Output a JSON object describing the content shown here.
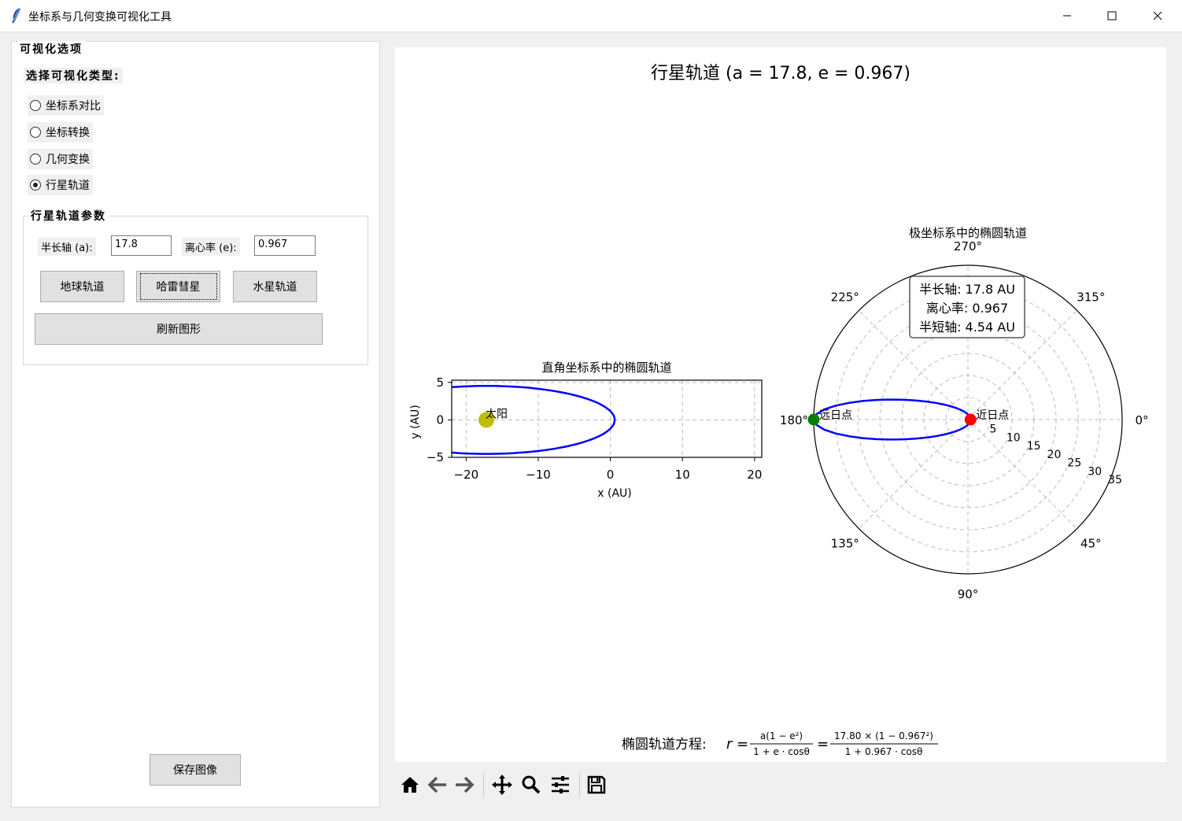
{
  "window": {
    "title": "坐标系与几何变换可视化工具"
  },
  "sidebar": {
    "group_title": "可视化选项",
    "type_label": "选择可视化类型:",
    "radios": [
      {
        "label": "坐标系对比",
        "selected": false
      },
      {
        "label": "坐标转换",
        "selected": false
      },
      {
        "label": "几何变换",
        "selected": false
      },
      {
        "label": "行星轨道",
        "selected": true
      }
    ],
    "params_title": "行星轨道参数",
    "a_label": "半长轴 (a):",
    "a_value": "17.8",
    "e_label": "离心率 (e):",
    "e_value": "0.967",
    "preset_buttons": [
      "地球轨道",
      "哈雷彗星",
      "水星轨道"
    ],
    "refresh_label": "刷新图形",
    "save_label": "保存图像"
  },
  "figure": {
    "suptitle": "行星轨道 (a = 17.8, e = 0.967)",
    "equation_prefix": "椭圆轨道方程:",
    "equation_general_num": "a(1 − e²)",
    "equation_general_den": "1 + e · cosθ",
    "equation_specific_num": "17.80 × (1 − 0.967²)",
    "equation_specific_den": "1 + 0.967 · cosθ"
  },
  "chart_data": [
    {
      "type": "line",
      "title": "直角坐标系中的椭圆轨道",
      "xlabel": "x (AU)",
      "ylabel": "y (AU)",
      "xlim": [
        -22,
        21
      ],
      "ylim": [
        -5,
        5.3
      ],
      "xticks": [
        "−20",
        "−10",
        "0",
        "10",
        "20"
      ],
      "yticks": [
        "5",
        "0",
        "−5"
      ],
      "grid": true,
      "series": [
        {
          "name": "",
          "color": "#0000ff",
          "semi_major": 17.8,
          "eccentricity": 0.967,
          "center_x": -17.2,
          "semi_minor": 4.54
        }
      ],
      "points": [
        {
          "label": "太阳",
          "x": -17.2,
          "y": 0,
          "color": "#bfbf00"
        }
      ]
    },
    {
      "type": "polar",
      "title": "极坐标系中的椭圆轨道",
      "theta_labels": [
        "0°",
        "315°",
        "270°",
        "225°",
        "180°",
        "135°",
        "90°",
        "45°"
      ],
      "r_labels": [
        "5",
        "10",
        "15",
        "20",
        "25",
        "30",
        "35"
      ],
      "rmax": 35,
      "grid": true,
      "series": [
        {
          "name": "",
          "color": "#0000ff",
          "semi_major": 17.8,
          "eccentricity": 0.967
        }
      ],
      "points": [
        {
          "label": "近日点",
          "theta_deg": 0,
          "r": 0.59,
          "color": "#ff0000"
        },
        {
          "label": "远日点",
          "theta_deg": 180,
          "r": 35.0,
          "color": "#008000"
        }
      ],
      "info_box": [
        "半长轴: 17.8 AU",
        "离心率: 0.967",
        "半短轴: 4.54 AU"
      ]
    }
  ],
  "toolbar": {
    "icons": [
      "home-icon",
      "back-icon",
      "forward-icon",
      "pan-icon",
      "zoom-icon",
      "configure-icon",
      "save-icon"
    ]
  }
}
